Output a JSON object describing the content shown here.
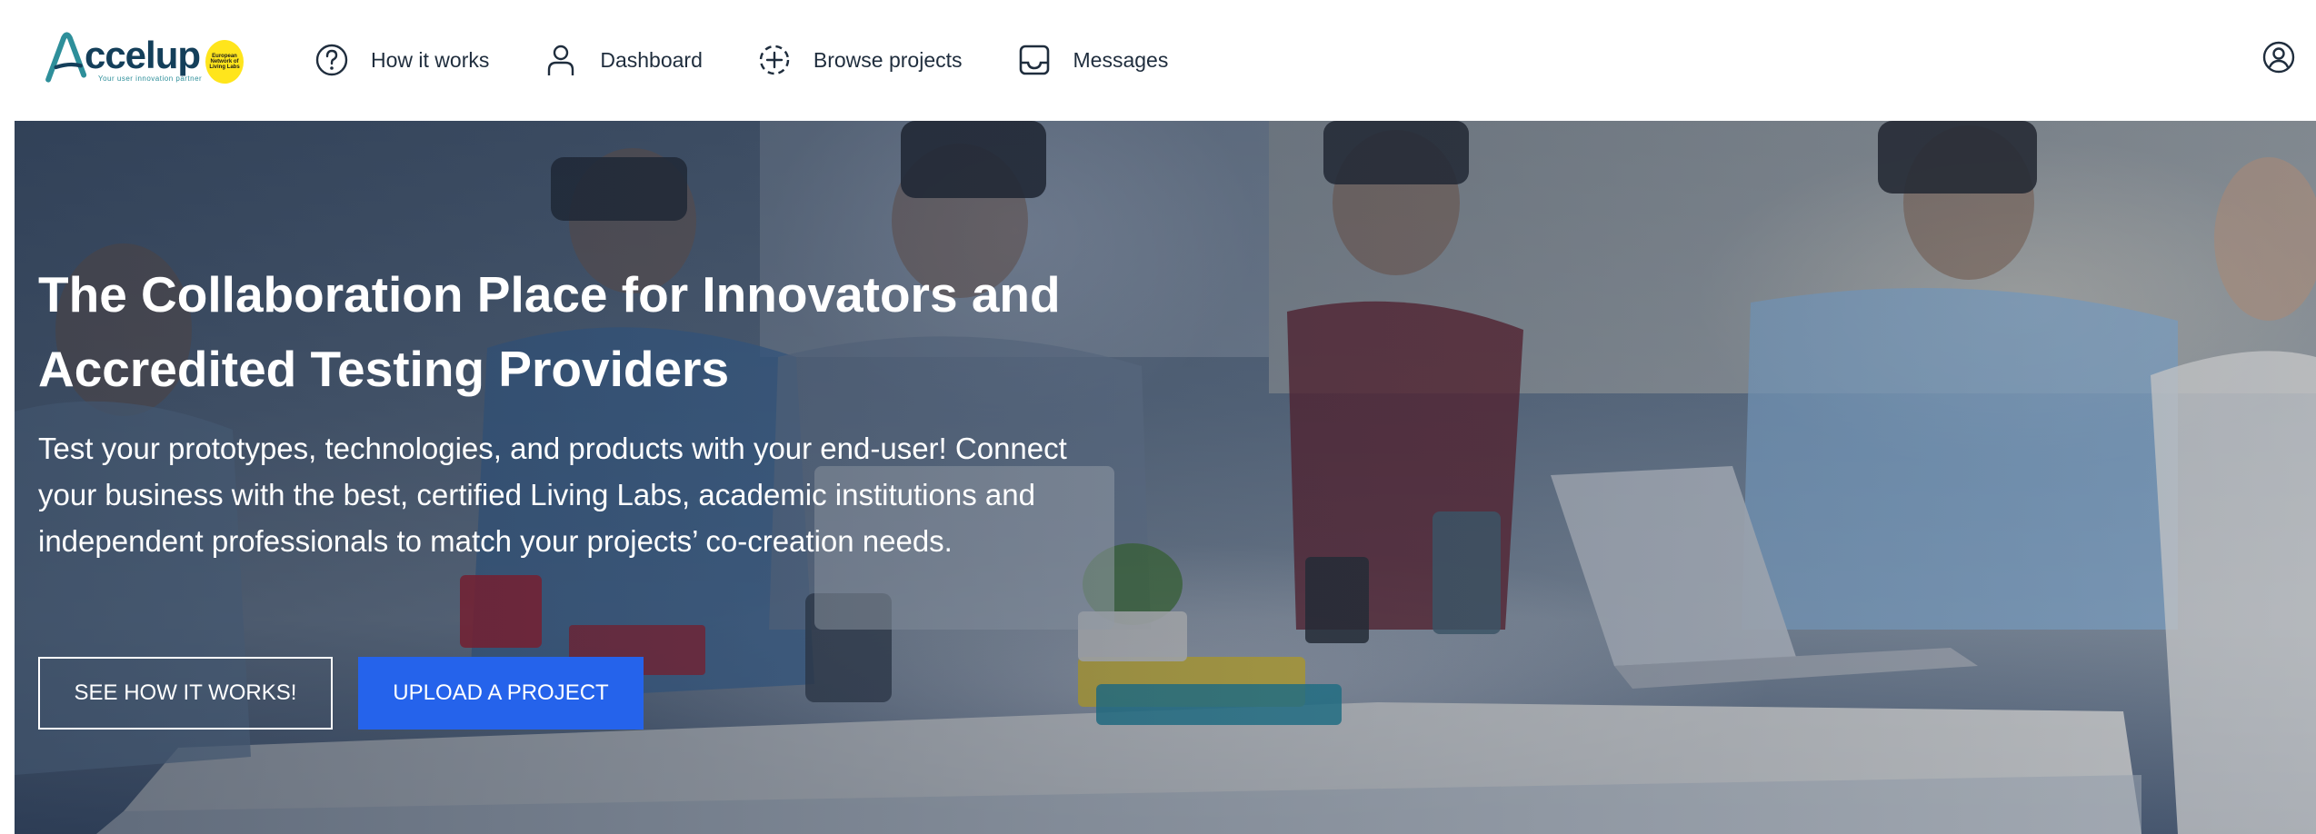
{
  "nav": {
    "logo_text": "ccelup",
    "logo_tagline": "Your user innovation partner",
    "logo_badge": "European Network of Living Labs",
    "items": [
      {
        "label": "How it works",
        "icon": "question-circle-icon"
      },
      {
        "label": "Dashboard",
        "icon": "user-icon"
      },
      {
        "label": "Browse projects",
        "icon": "browse-target-icon"
      },
      {
        "label": "Messages",
        "icon": "inbox-icon"
      }
    ],
    "profile_icon": "account-circle-icon"
  },
  "hero": {
    "title": "The Collaboration Place for Innovators and Accredited Testing Providers",
    "text": "Test your prototypes, technologies, and products with your end-user! Connect your business with the best, certified Living Labs, academic institutions and independent professionals to match your projects’ co-creation needs.",
    "buttons": {
      "secondary": "SEE HOW IT WORKS!",
      "primary": "UPLOAD A PROJECT"
    }
  },
  "colors": {
    "brand_dark": "#143f5a",
    "brand_teal": "#2e8f9a",
    "primary_button": "#2563eb",
    "badge_yellow": "#ffe51c"
  }
}
